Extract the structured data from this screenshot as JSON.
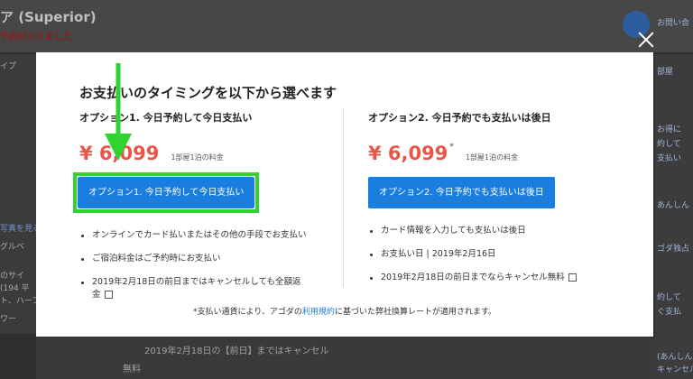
{
  "background": {
    "title": "ア (Superior)",
    "subtitle": "予約が入りました",
    "left_fragments": [
      "イプ",
      "写真を見る",
      "グルベ",
      "のサイ",
      "(194 平",
      "ト、ハーフ",
      "ワー"
    ],
    "right_fragments": [
      "お問い合",
      "部屋",
      "お得に",
      "約して",
      "支払い",
      "あんしん",
      "ゴダ独占",
      "約して",
      "ぐ支払",
      "(あんしん)",
      "キャンセル料"
    ],
    "bottom_text": "2019年2月18日の【前日】まではキャンセル",
    "bottom_text2": "無料"
  },
  "modal": {
    "title": "お支払いのタイミングを以下から選べます",
    "option1": {
      "title": "オプション1. 今日予約して今日支払い",
      "price": "¥ 6,099",
      "per_night": "1部屋1泊の料金",
      "button_label": "オプション1. 今日予約して今日支払い",
      "bullets": [
        "オンラインでカード払いまたはその他の手段でお支払い",
        "ご宿泊料金はご予約時にお支払い",
        "2019年2月18日の前日まではキャンセルしても全額返",
        "金"
      ]
    },
    "option2": {
      "title": "オプション2. 今日予約でも支払いは後日",
      "price": "¥ 6,099",
      "asterisk": "*",
      "per_night": "1部屋1泊の料金",
      "button_label": "オプション2. 今日予約でも支払いは後日",
      "bullets": [
        "カード情報を入力しても支払いは後日",
        "お支払い日 | 2019年2月16日",
        "2019年2月18日の前日までならキャンセル無料"
      ]
    },
    "footnote_prefix": "*支払い通貨により、アゴダの",
    "footnote_link": "利用規約",
    "footnote_suffix": "に基づいた弊社換算レートが適用されます。"
  },
  "colors": {
    "accent_blue": "#1a7ee0",
    "price_red": "#e8564b",
    "highlight_green": "#2fd42f"
  },
  "icons": [
    "close-icon",
    "external-link-icon",
    "annotation-arrow"
  ]
}
